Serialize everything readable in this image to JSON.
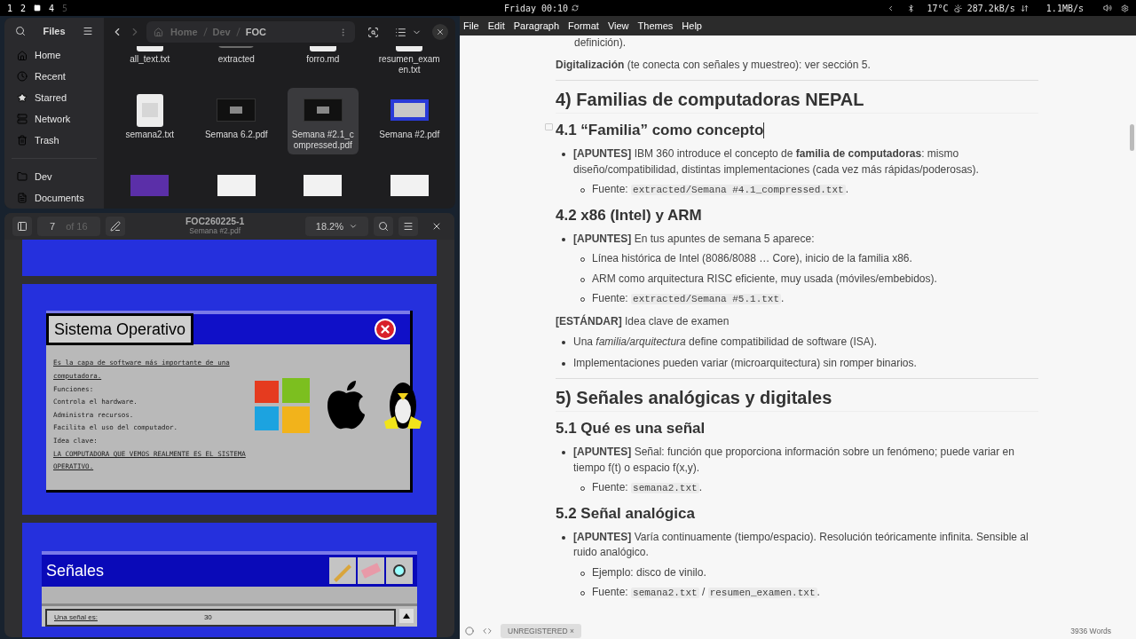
{
  "top_bar": {
    "workspaces": [
      {
        "label": "1",
        "selected": false,
        "occupied": true
      },
      {
        "label": "2",
        "selected": false,
        "occupied": true
      },
      {
        "selected": true,
        "occupied": true
      },
      {
        "label": "4",
        "selected": false,
        "occupied": true
      },
      {
        "label": "5",
        "selected": false,
        "occupied": false
      }
    ],
    "clock": "Friday 00:10",
    "weather": "17°C",
    "upload": "287.2kB/s",
    "download": "1.1MB/s"
  },
  "files": {
    "title": "Files",
    "places": [
      {
        "kind": "home",
        "label": "Home"
      },
      {
        "kind": "recent",
        "label": "Recent"
      },
      {
        "kind": "starred",
        "label": "Starred"
      },
      {
        "kind": "network",
        "label": "Network"
      },
      {
        "kind": "trash",
        "label": "Trash"
      }
    ],
    "bookmarks": [
      {
        "kind": "folder",
        "label": "Dev"
      },
      {
        "kind": "document",
        "label": "Documents"
      }
    ],
    "forward_disabled": true,
    "path": [
      "Home",
      "Dev",
      "FOC"
    ],
    "items": [
      {
        "name": "all_text.txt",
        "kind": "document",
        "selected": false
      },
      {
        "name": "extracted",
        "kind": "folder",
        "selected": false
      },
      {
        "name": "forro.md",
        "kind": "document",
        "selected": false
      },
      {
        "name": "resumen_examen.txt",
        "kind": "document",
        "selected": false
      },
      {
        "name": "semana2.txt",
        "kind": "document",
        "selected": false
      },
      {
        "name": "Semana 6.2.pdf",
        "kind": "dark",
        "selected": false
      },
      {
        "name": "Semana #2.1_compressed.pdf",
        "kind": "dark",
        "selected": true
      },
      {
        "name": "Semana #2.pdf",
        "kind": "blue",
        "selected": false
      },
      {
        "kind": "purple",
        "selected": false
      },
      {
        "kind": "white",
        "selected": false
      },
      {
        "kind": "white",
        "selected": false
      },
      {
        "kind": "white",
        "selected": false
      }
    ]
  },
  "pdf": {
    "page": "7",
    "page_count": "of 16",
    "title": "FOC260225-1",
    "subtitle": "Semana #2.pdf",
    "zoom": "18.2%",
    "slides": [
      {
        "kind": "blank"
      },
      {
        "kind": "window",
        "title": "Sistema Operativo",
        "lines": [
          {
            "text": "Es la capa de software más importante de una",
            "underlined": true
          },
          {
            "text": "computadora.",
            "underlined": true
          },
          {
            "text": "Funciones:",
            "underlined": false
          },
          {
            "text": "Controla el hardware.",
            "underlined": false
          },
          {
            "text": "Administra recursos.",
            "underlined": false
          },
          {
            "text": "Facilita el uso del computador.",
            "underlined": false
          },
          {
            "text": "Idea clave:",
            "underlined": false
          },
          {
            "text": "LA COMPUTADORA QUE VEMOS REALMENTE ES EL SISTEMA",
            "underlined": true
          },
          {
            "text": "OPERATIVO.",
            "underlined": true
          }
        ]
      },
      {
        "kind": "tool-window",
        "title": "Señales",
        "body_label": "Una señal es:",
        "axis_value": "30"
      }
    ]
  },
  "editor": {
    "menu": [
      "File",
      "Edit",
      "Paragraph",
      "Format",
      "View",
      "Themes",
      "Help"
    ],
    "blocks": [
      {
        "kind": "continuation",
        "text": "definición)."
      },
      {
        "kind": "paragraph",
        "text": "**Digitalización** (te conecta con señales y muestreo): ver sección 5."
      },
      {
        "kind": "rule"
      },
      {
        "kind": "h2",
        "text": "4) Familias de computadoras NEPAL"
      },
      {
        "kind": "h3",
        "text": "4.1 “Familia” como concepto",
        "focused": true
      },
      {
        "kind": "bullet",
        "text": "**[APUNTES]** IBM 360 introduce el concepto de **familia de computadoras**: mismo diseño/compatibilidad, distintas implementaciones (cada vez más rápidas/poderosas).",
        "children": [
          {
            "segments": [
              {
                "kind": "text",
                "text": "Fuente: "
              },
              {
                "kind": "code",
                "text": "extracted/Semana #4.1_compressed.txt"
              },
              {
                "kind": "text",
                "text": "."
              }
            ]
          }
        ]
      },
      {
        "kind": "h3",
        "text": "4.2 x86 (Intel) y ARM",
        "focused": false
      },
      {
        "kind": "bullet",
        "text": "**[APUNTES]** En tus apuntes de semana 5 aparece:",
        "children": [
          {
            "text": "Línea histórica de Intel (8086/8088 … Core), inicio de la familia x86."
          },
          {
            "text": "ARM como arquitectura RISC eficiente, muy usada (móviles/embebidos)."
          },
          {
            "segments": [
              {
                "kind": "text",
                "text": "Fuente: "
              },
              {
                "kind": "code",
                "text": "extracted/Semana #5.1.txt"
              },
              {
                "kind": "text",
                "text": "."
              }
            ]
          }
        ]
      },
      {
        "kind": "paragraph",
        "text": "**[ESTÁNDAR]** Idea clave de examen"
      },
      {
        "kind": "bullet",
        "text": "Una *familia/arquitectura* define compatibilidad de software (ISA)."
      },
      {
        "kind": "bullet",
        "text": "Implementaciones pueden variar (microarquitectura) sin romper binarios."
      },
      {
        "kind": "rule"
      },
      {
        "kind": "h2",
        "text": "5) Señales analógicas y digitales"
      },
      {
        "kind": "h3",
        "text": "5.1 Qué es una señal",
        "focused": false
      },
      {
        "kind": "bullet",
        "text": "**[APUNTES]** Señal: función que proporciona información sobre un fenómeno; puede variar en tiempo f(t) o espacio f(x,y).",
        "children": [
          {
            "segments": [
              {
                "kind": "text",
                "text": "Fuente: "
              },
              {
                "kind": "code",
                "text": "semana2.txt"
              },
              {
                "kind": "text",
                "text": "."
              }
            ]
          }
        ]
      },
      {
        "kind": "h3",
        "text": "5.2 Señal analógica",
        "focused": false
      },
      {
        "kind": "bullet",
        "text": "**[APUNTES]** Varía continuamente (tiempo/espacio). Resolución teóricamente infinita. Sensible al ruido analógico.",
        "children": [
          {
            "text": "Ejemplo: disco de vinilo."
          },
          {
            "segments": [
              {
                "kind": "text",
                "text": "Fuente: "
              },
              {
                "kind": "code",
                "text": "semana2.txt"
              },
              {
                "kind": "text",
                "text": " / "
              },
              {
                "kind": "code",
                "text": "resumen_examen.txt"
              },
              {
                "kind": "text",
                "text": "."
              }
            ]
          }
        ]
      }
    ],
    "badge": "UNREGISTERED ×",
    "word_count": "3936 Words"
  }
}
